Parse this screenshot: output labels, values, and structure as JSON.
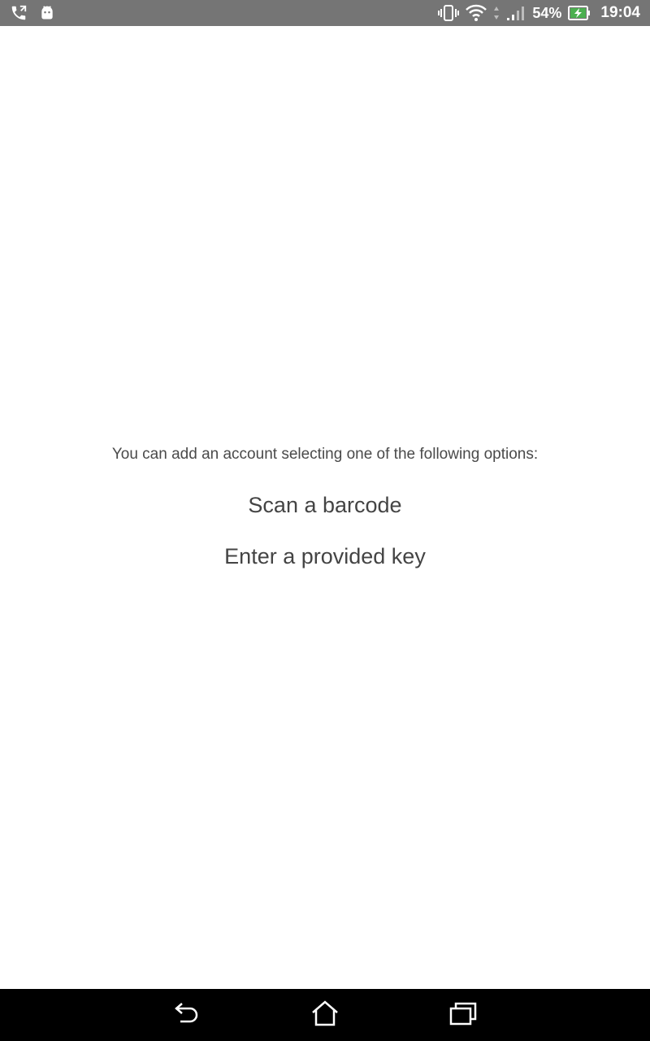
{
  "status_bar": {
    "left_icons": [
      "phone-call-icon",
      "android-icon"
    ],
    "right_icons": [
      "vibrate-icon",
      "wifi-icon",
      "data-arrows-icon",
      "signal-icon",
      "battery-charging-icon"
    ],
    "battery_percent": "54%",
    "time": "19:04",
    "background": "#757575"
  },
  "main": {
    "instructions": "You can add an account selecting one of the following options:",
    "options": [
      {
        "label": "Scan a barcode"
      },
      {
        "label": "Enter a provided key"
      }
    ]
  },
  "nav_bar": {
    "buttons": [
      "back-icon",
      "home-icon",
      "recent-apps-icon"
    ],
    "background": "#000000"
  }
}
